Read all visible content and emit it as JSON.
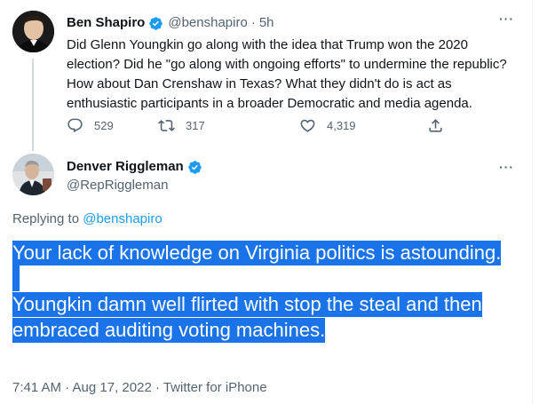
{
  "parent_tweet": {
    "name": "Ben Shapiro",
    "handle": "@benshapiro",
    "separator": "·",
    "time": "5h",
    "more_label": "···",
    "text": "Did Glenn Youngkin go along with the idea that Trump won the 2020 election? Did he \"go along with ongoing efforts\" to undermine the republic? How about Dan Crenshaw in Texas? What they didn't do is act as enthusiastic participants in a broader Democratic and media agenda.",
    "replies": "529",
    "retweets": "317",
    "likes": "4,319"
  },
  "reply_tweet": {
    "name": "Denver Riggleman",
    "handle": "@RepRiggleman",
    "more_label": "···",
    "replying_prefix": "Replying to",
    "replying_to": "@benshapiro",
    "paragraph_1": "Your lack of knowledge on Virginia politics is astounding.",
    "paragraph_2": "Youngkin damn well flirted with stop the steal and then embraced auditing voting machines.",
    "timestamp": "7:41 AM · Aug 17, 2022 · Twitter for iPhone"
  },
  "colors": {
    "verified": "#1d9bf0",
    "link": "#1d9bf0",
    "secondary_text": "#536471",
    "selection_highlight": "#1a73e8",
    "thread_line": "#cfd9de"
  },
  "icons": {
    "reply": "reply-icon",
    "retweet": "retweet-icon",
    "like": "heart-icon",
    "share": "share-icon",
    "verified": "verified-badge-icon",
    "more": "more-icon"
  }
}
